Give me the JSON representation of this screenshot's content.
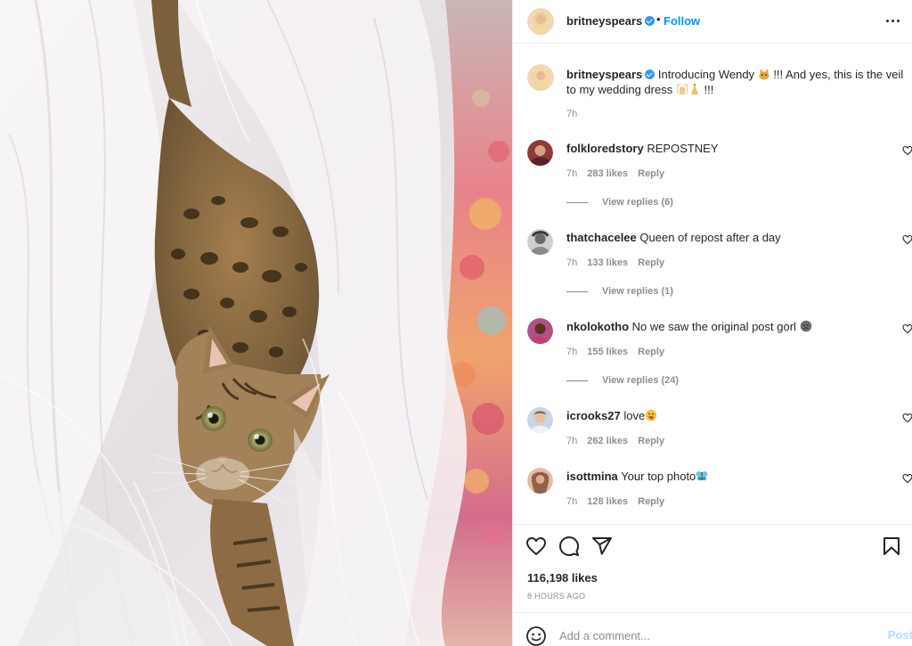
{
  "header": {
    "username": "britneyspears",
    "separator": "•",
    "follow_label": "Follow"
  },
  "caption": {
    "username": "britneyspears",
    "text_part1": "Introducing Wendy",
    "text_part2": "!!! And yes, this is the veil to my wedding dress",
    "text_part3": "!!!",
    "time": "7h"
  },
  "comments": [
    {
      "username": "folkloredstory",
      "text": "REPOSTNEY",
      "time": "7h",
      "likes": "283 likes",
      "reply": "Reply",
      "view_replies": "View replies (6)"
    },
    {
      "username": "thatchacelee",
      "text": "Queen of repost after a day",
      "time": "7h",
      "likes": "133 likes",
      "reply": "Reply",
      "view_replies": "View replies (1)"
    },
    {
      "username": "nkolokotho",
      "text": "No we saw the original post gorl",
      "time": "7h",
      "likes": "155 likes",
      "reply": "Reply",
      "view_replies": "View replies (24)"
    },
    {
      "username": "icrooks27",
      "text": "love",
      "time": "7h",
      "likes": "262 likes",
      "reply": "Reply"
    },
    {
      "username": "isottmina",
      "text": "Your top photo",
      "time": "7h",
      "likes": "128 likes",
      "reply": "Reply"
    }
  ],
  "stats": {
    "likes": "116,198 likes",
    "time_ago": "8 HOURS AGO"
  },
  "composer": {
    "placeholder": "Add a comment...",
    "post_label": "Post"
  },
  "icons": {
    "verified": "verified-badge-icon",
    "more": "more-options-icon",
    "like": "heart-icon",
    "comment": "comment-bubble-icon",
    "share": "paper-plane-icon",
    "save": "bookmark-icon",
    "emoji": "smiley-icon"
  },
  "colors": {
    "accent": "#0095f6",
    "verified": "#3897f0",
    "muted": "#8e8e8e",
    "post_disabled": "#b3dbff"
  }
}
